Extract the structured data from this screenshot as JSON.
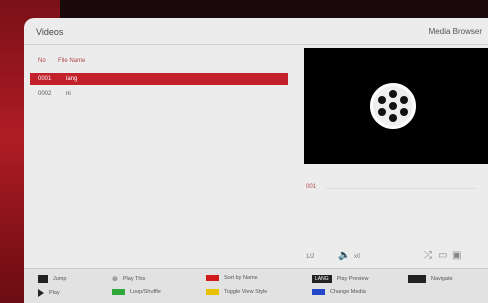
{
  "app": {
    "title": "Videos",
    "section": "Media Browser"
  },
  "list": {
    "headers": {
      "no": "No",
      "name": "File Name"
    },
    "rows": [
      {
        "no": "0001",
        "name": "lang",
        "selected": true
      },
      {
        "no": "0002",
        "name": "ni",
        "selected": false
      }
    ]
  },
  "preview": {
    "label": "001",
    "status_page": "1/2",
    "status_volume": "x0"
  },
  "footer": {
    "jump": "Jump",
    "play": "Play",
    "play_this": "Play This",
    "loop_shuffle": "Loop/Shuffle",
    "sort_by_name": "Sort by Name",
    "toggle_view_style": "Toggle View Style",
    "play_preview_key": "LANG",
    "play_preview": "Play Preview",
    "change_media": "Change Media",
    "navigate": "Navigate"
  },
  "colors": {
    "selected": "#c2202a",
    "green": "#2faa3a",
    "yellow": "#e8c000",
    "red": "#d11a1a",
    "blue": "#2446c9"
  }
}
